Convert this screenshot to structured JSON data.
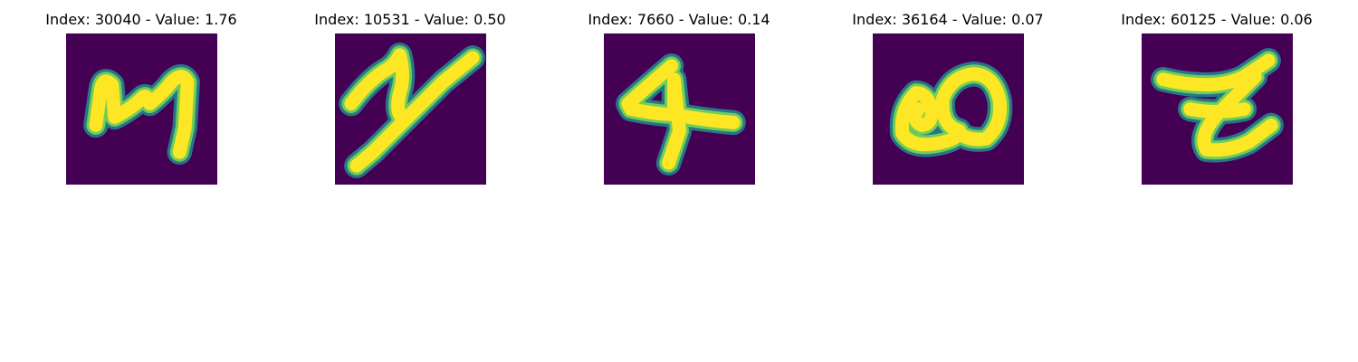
{
  "panels": [
    {
      "title": "Index: 30040 - Value: 1.76",
      "index": 30040,
      "value": 1.76,
      "glyph": "handwritten-4-or-4-like",
      "colormap": "viridis"
    },
    {
      "title": "Index: 10531 - Value: 0.50",
      "index": 10531,
      "value": 0.5,
      "glyph": "handwritten-y-like",
      "colormap": "viridis"
    },
    {
      "title": "Index: 7660 - Value: 0.14",
      "index": 7660,
      "value": 0.14,
      "glyph": "handwritten-4",
      "colormap": "viridis"
    },
    {
      "title": "Index: 36164 - Value: 0.07",
      "index": 36164,
      "value": 0.07,
      "glyph": "handwritten-loop-a-like",
      "colormap": "viridis"
    },
    {
      "title": "Index: 60125 - Value: 0.06",
      "index": 60125,
      "value": 0.06,
      "glyph": "handwritten-z-like",
      "colormap": "viridis"
    }
  ],
  "colors": {
    "background": "#440154",
    "edge_teal": "#26828e",
    "edge_green": "#6ece58",
    "stroke_yellow": "#fde725"
  }
}
